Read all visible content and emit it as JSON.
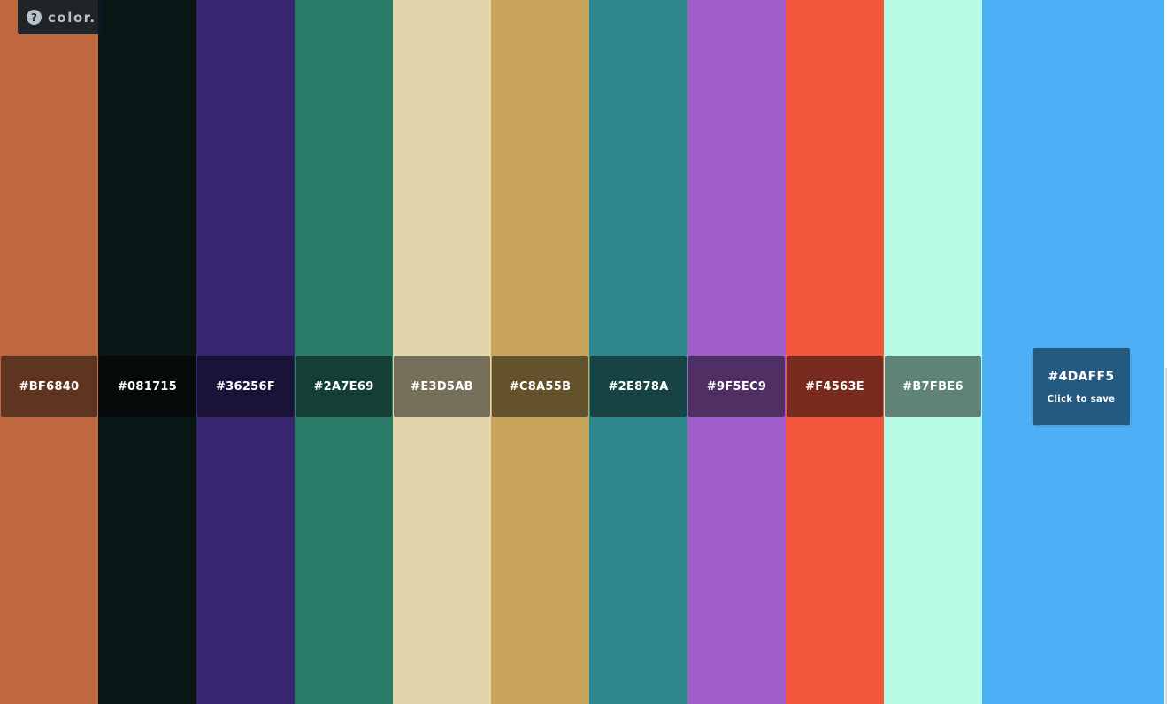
{
  "brand": {
    "icon": "question-mark-icon",
    "icon_glyph": "?",
    "name": "color."
  },
  "palette": [
    {
      "hex": "#BF6840",
      "color": "#BF6840"
    },
    {
      "hex": "#081715",
      "color": "#081715"
    },
    {
      "hex": "#36256F",
      "color": "#36256F"
    },
    {
      "hex": "#2A7E69",
      "color": "#2A7E69"
    },
    {
      "hex": "#E3D5AB",
      "color": "#E3D5AB"
    },
    {
      "hex": "#C8A55B",
      "color": "#C8A55B"
    },
    {
      "hex": "#2E878A",
      "color": "#2E878A"
    },
    {
      "hex": "#9F5EC9",
      "color": "#9F5EC9"
    },
    {
      "hex": "#F4563E",
      "color": "#F4563E"
    },
    {
      "hex": "#B7FBE6",
      "color": "#B7FBE6"
    }
  ],
  "current": {
    "hex": "#4DAFF5",
    "color": "#4DAFF5",
    "save_label": "Click to save"
  }
}
